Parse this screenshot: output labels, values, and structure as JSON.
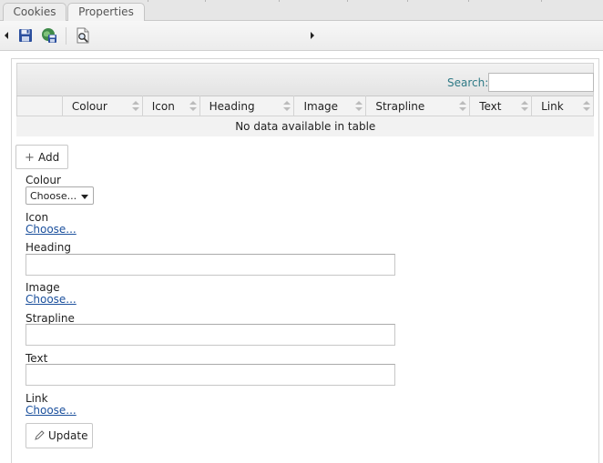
{
  "tabs": [
    {
      "label": "Cookies"
    },
    {
      "label": "Properties"
    }
  ],
  "toolbar": {
    "icons": [
      "save-icon",
      "save-publish-icon",
      "preview-icon"
    ]
  },
  "table": {
    "search_label": "Search:",
    "search_value": "",
    "columns": [
      "",
      "Colour",
      "Icon",
      "Heading",
      "Image",
      "Strapline",
      "Text",
      "Link"
    ],
    "empty_message": "No data available in table"
  },
  "form": {
    "add_label": "Add",
    "colour_label": "Colour",
    "colour_select": "Choose...",
    "icon_label": "Icon",
    "icon_link": "Choose...",
    "heading_label": "Heading",
    "heading_value": "",
    "image_label": "Image",
    "image_link": "Choose...",
    "strapline_label": "Strapline",
    "strapline_value": "",
    "text_label": "Text",
    "text_value": "",
    "link_label": "Link",
    "link_link": "Choose...",
    "update_label": "Update"
  },
  "colors": {
    "search_label": "#2f7a86",
    "link": "#1a4f9c"
  }
}
